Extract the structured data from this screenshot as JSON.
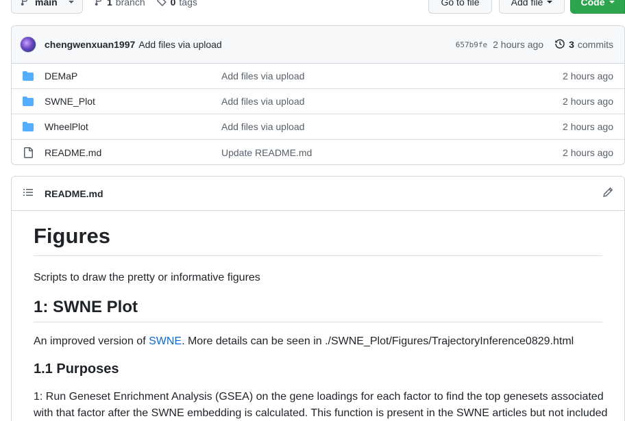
{
  "toolbar": {
    "branch_label": "main",
    "branches_count": "1",
    "branches_label": "branch",
    "tags_count": "0",
    "tags_label": "tags",
    "goto_file_label": "Go to file",
    "add_file_label": "Add file",
    "code_label": "Code"
  },
  "commit": {
    "user": "chengwenxuan1997",
    "message": "Add files via upload",
    "sha": "657b9fe",
    "time": "2 hours ago",
    "commits_count": "3",
    "commits_label": "commits"
  },
  "files": [
    {
      "type": "folder",
      "name": "DEMaP",
      "commit": "Add files via upload",
      "time": "2 hours ago"
    },
    {
      "type": "folder",
      "name": "SWNE_Plot",
      "commit": "Add files via upload",
      "time": "2 hours ago"
    },
    {
      "type": "folder",
      "name": "WheelPlot",
      "commit": "Add files via upload",
      "time": "2 hours ago"
    },
    {
      "type": "file",
      "name": "README.md",
      "commit": "Update README.md",
      "time": "2 hours ago"
    }
  ],
  "readme": {
    "header_title": "README.md",
    "h1": "Figures",
    "intro": "Scripts to draw the pretty or informative figures",
    "h2": "1: SWNE Plot",
    "p2_prefix": "An improved version of ",
    "p2_link": "SWNE",
    "p2_suffix": ". More details can be seen in ./SWNE_Plot/Figures/TrajectoryInference0829.html",
    "h3": "1.1 Purposes",
    "p3_line1": "1: Run Geneset Enrichment Analysis (GSEA) on the gene loadings for each factor to find the top genesets associated",
    "p3_line2": "with that factor after the SWNE embedding is calculated. This function is present in the SWNE articles but not included"
  },
  "colors": {
    "accent_green": "#2da44e",
    "link_blue": "#0969da",
    "folder_blue": "#54aeff"
  }
}
